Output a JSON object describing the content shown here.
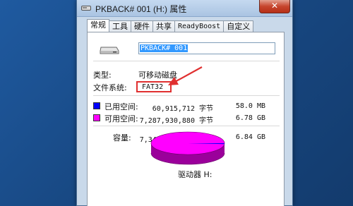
{
  "window": {
    "title": "PKBACK# 001 (H:) 属性",
    "close_label": "✕"
  },
  "tabs": [
    {
      "label": "常规"
    },
    {
      "label": "工具"
    },
    {
      "label": "硬件"
    },
    {
      "label": "共享"
    },
    {
      "label": "ReadyBoost"
    },
    {
      "label": "自定义"
    }
  ],
  "general": {
    "drive_name": "PKBACK# 001",
    "type_label": "类型:",
    "type_value": "可移动磁盘",
    "fs_label": "文件系统:",
    "fs_value": "FAT32",
    "used": {
      "label": "已用空间:",
      "bytes": "60,915,712 字节",
      "size": "58.0 MB",
      "color": "#0000ff"
    },
    "free": {
      "label": "可用空间:",
      "bytes": "7,287,930,880 字节",
      "size": "6.78 GB",
      "color": "#ff00ff"
    },
    "capacity": {
      "label": "容量:",
      "bytes": "7,348,846,592 字节",
      "size": "6.84 GB"
    },
    "drive_caption": "驱动器 H:"
  },
  "colors": {
    "annotation": "#e03030"
  }
}
